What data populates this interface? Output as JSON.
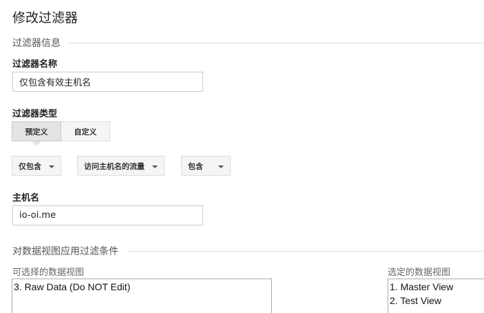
{
  "page": {
    "title": "修改过滤器"
  },
  "filter_info": {
    "section_label": "过滤器信息",
    "name_label": "过滤器名称",
    "name_value": "仅包含有效主机名",
    "type_label": "过滤器类型",
    "type_options": [
      "预定义",
      "自定义"
    ],
    "selected_type": "预定义",
    "dropdowns": [
      {
        "value": "仅包含",
        "icon": "chevron-down-icon"
      },
      {
        "value": "访问主机名的流量",
        "icon": "chevron-down-icon"
      },
      {
        "value": "包含",
        "icon": "chevron-down-icon"
      }
    ],
    "hostname_label": "主机名",
    "hostname_value": "io-oi.me"
  },
  "views": {
    "section_label": "对数据视图应用过滤条件",
    "available_label": "可选择的数据视图",
    "available": [
      "3. Raw Data (Do NOT Edit)"
    ],
    "selected_label": "选定的数据视图",
    "selected": [
      "1. Master View",
      "2. Test View"
    ]
  }
}
